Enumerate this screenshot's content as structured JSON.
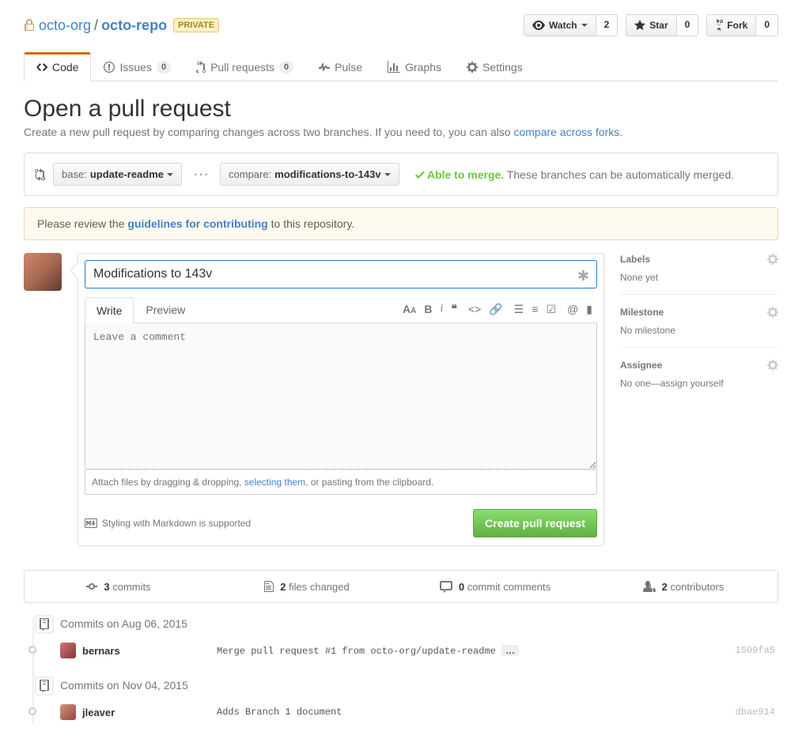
{
  "repo": {
    "org": "octo-org",
    "name": "octo-repo",
    "privacy": "Private"
  },
  "actions": {
    "watch": {
      "label": "Watch",
      "count": "2"
    },
    "star": {
      "label": "Star",
      "count": "0"
    },
    "fork": {
      "label": "Fork",
      "count": "0"
    }
  },
  "nav": {
    "code": "Code",
    "issues": {
      "label": "Issues",
      "count": "0"
    },
    "pulls": {
      "label": "Pull requests",
      "count": "0"
    },
    "pulse": "Pulse",
    "graphs": "Graphs",
    "settings": "Settings"
  },
  "page": {
    "title": "Open a pull request",
    "subtitle_pre": "Create a new pull request by comparing changes across two branches. If you need to, you can also ",
    "subtitle_link": "compare across forks",
    "subtitle_post": "."
  },
  "compare": {
    "base_label": "base:",
    "base_value": "update-readme",
    "compare_label": "compare:",
    "compare_value": "modifications-to-143v",
    "status_ok": "Able to merge.",
    "status_rest": "These branches can be automatically merged."
  },
  "banner": {
    "pre": "Please review the ",
    "link": "guidelines for contributing",
    "post": " to this repository."
  },
  "form": {
    "title_value": "Modifications to 143v",
    "write_tab": "Write",
    "preview_tab": "Preview",
    "comment_placeholder": "Leave a comment",
    "attach_pre": "Attach files by dragging & dropping, ",
    "attach_link": "selecting them",
    "attach_post": ", or pasting from the clipboard.",
    "md_hint": "Styling with Markdown is supported",
    "submit": "Create pull request"
  },
  "sidebar": {
    "labels": {
      "heading": "Labels",
      "value": "None yet"
    },
    "milestone": {
      "heading": "Milestone",
      "value": "No milestone"
    },
    "assignee": {
      "heading": "Assignee",
      "value": "No one—assign yourself"
    }
  },
  "stats": {
    "commits": {
      "count": "3",
      "label": "commits"
    },
    "files": {
      "count": "2",
      "label": "files changed"
    },
    "comments": {
      "count": "0",
      "label": "commit comments"
    },
    "contrib": {
      "count": "2",
      "label": "contributors"
    }
  },
  "commit_groups": {
    "g1": {
      "title": "Commits on Aug 06, 2015",
      "c1": {
        "author": "bernars",
        "msg": "Merge pull request #1 from octo-org/update-readme",
        "sha": "1509fa5"
      }
    },
    "g2": {
      "title": "Commits on Nov 04, 2015",
      "c1": {
        "author": "jleaver",
        "msg": "Adds Branch 1 document",
        "sha": "dbae914"
      }
    }
  }
}
